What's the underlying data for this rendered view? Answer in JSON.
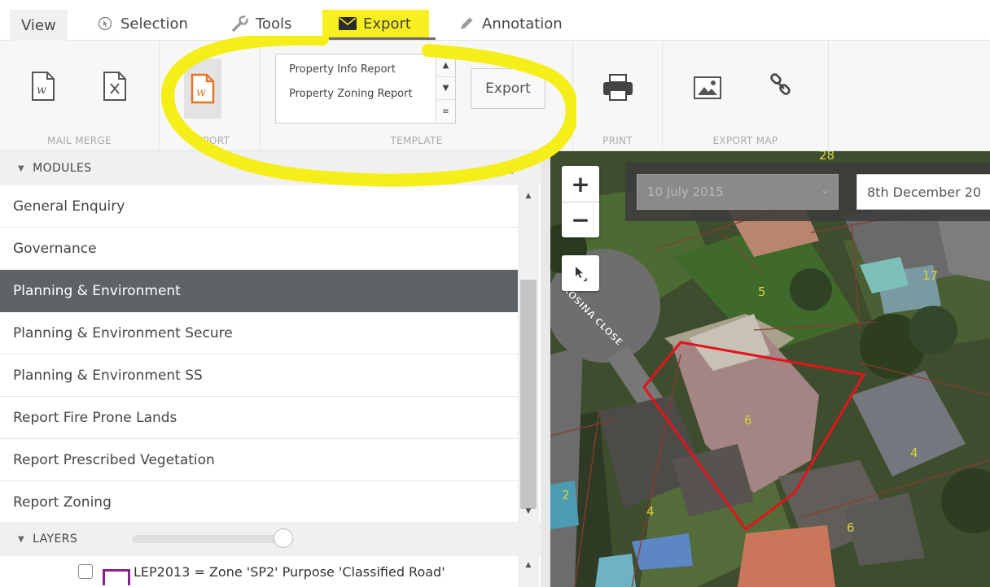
{
  "tabs": {
    "view": "View",
    "selection": "Selection",
    "tools": "Tools",
    "export": "Export",
    "annotation": "Annotation"
  },
  "ribbon": {
    "groups": {
      "mail_merge": "MAIL MERGE",
      "report": "REPORT",
      "template": "TEMPLATE",
      "print": "PRINT",
      "export_map": "EXPORT MAP"
    },
    "template_items": [
      "Property Info Report",
      "Property Zoning Report"
    ],
    "export_button": "Export"
  },
  "modules": {
    "header": "MODULES",
    "items": [
      "General Enquiry",
      "Governance",
      "Planning & Environment",
      "Planning & Environment Secure",
      "Planning & Environment SS",
      "Report Fire Prone Lands",
      "Report Prescribed Vegetation",
      "Report Zoning"
    ],
    "selected_index": 2
  },
  "layers": {
    "header": "LAYERS",
    "opacity_percent": 95,
    "items": [
      "LEP2013 = Zone 'SP2' Purpose 'Classified Road'"
    ]
  },
  "map": {
    "date_from": "10 July 2015",
    "date_to": "8th December 20",
    "street_label": "ROSINA CLOSE",
    "parcel_numbers": [
      "5",
      "6",
      "4",
      "17",
      "2",
      "4",
      "6",
      "28"
    ]
  },
  "colors": {
    "highlight": "#f5ee19",
    "selected_row": "#5f6368",
    "report_icon": "#e8742a",
    "parcel_outline": "#e3141b"
  }
}
